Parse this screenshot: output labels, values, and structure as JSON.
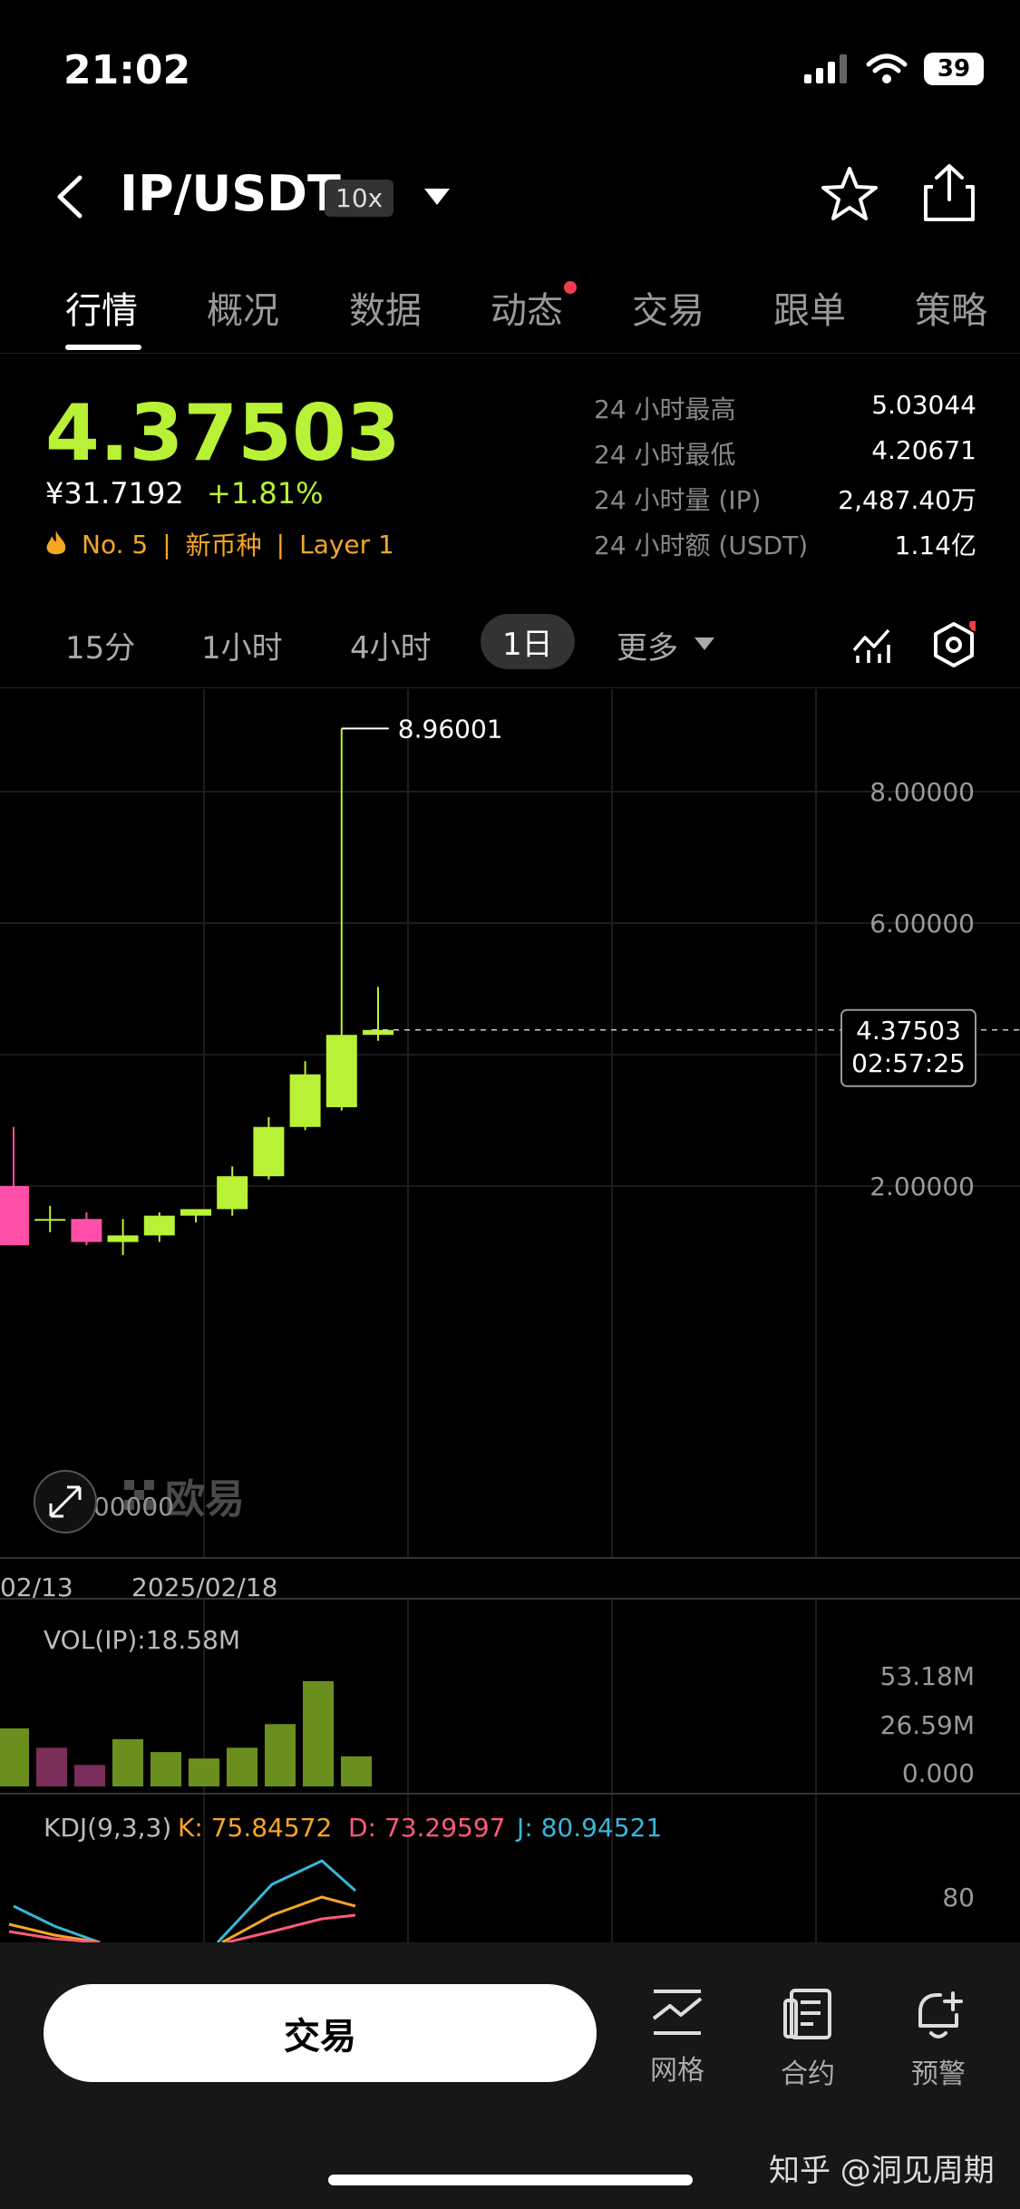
{
  "status": {
    "time": "21:02",
    "battery": "39"
  },
  "header": {
    "pair": "IP/USDT",
    "leverage": "10x"
  },
  "tabs": [
    {
      "label": "行情"
    },
    {
      "label": "概况"
    },
    {
      "label": "数据"
    },
    {
      "label": "动态"
    },
    {
      "label": "交易"
    },
    {
      "label": "跟单"
    },
    {
      "label": "策略"
    }
  ],
  "ticker": {
    "price": "4.37503",
    "price_cny": "¥31.7192",
    "change": "+1.81%",
    "rank": "No. 5",
    "tag_new": "新币种",
    "tag_layer": "Layer 1",
    "stats": [
      {
        "label": "24 小时最高",
        "value": "5.03044"
      },
      {
        "label": "24 小时最低",
        "value": "4.20671"
      },
      {
        "label": "24 小时量 (IP)",
        "value": "2,487.40万"
      },
      {
        "label": "24 小时额 (USDT)",
        "value": "1.14亿"
      }
    ]
  },
  "timeframes": {
    "m15": "15分",
    "h1": "1小时",
    "h4": "4小时",
    "d1": "1日",
    "more": "更多"
  },
  "colors": {
    "up": "#b8f135",
    "down": "#ff4fa8",
    "vol_up": "#6b8f1e",
    "vol_down": "#7a2e5a",
    "k": "#f5a623",
    "d": "#ff5a7a",
    "j": "#38b6d8"
  },
  "chart_data": {
    "type": "candlestick",
    "price_axis": {
      "ticks": [
        "8.00000",
        "6.00000",
        "2.00000",
        "1.00000"
      ],
      "ylim": [
        1.0,
        9.0
      ]
    },
    "dates": {
      "d1": "02/13",
      "d2": "2025/02/18"
    },
    "high_label": "8.96001",
    "current": {
      "price": "4.37503",
      "countdown": "02:57:25"
    },
    "candles": [
      {
        "o": 2.0,
        "h": 2.9,
        "l": 1.1,
        "c": 1.1
      },
      {
        "o": 1.5,
        "h": 1.7,
        "l": 1.3,
        "c": 1.5
      },
      {
        "o": 1.5,
        "h": 1.6,
        "l": 1.1,
        "c": 1.15
      },
      {
        "o": 1.15,
        "h": 1.5,
        "l": 0.95,
        "c": 1.25
      },
      {
        "o": 1.25,
        "h": 1.6,
        "l": 1.15,
        "c": 1.55
      },
      {
        "o": 1.55,
        "h": 1.6,
        "l": 1.45,
        "c": 1.65
      },
      {
        "o": 1.65,
        "h": 2.3,
        "l": 1.55,
        "c": 2.15
      },
      {
        "o": 2.15,
        "h": 3.05,
        "l": 2.1,
        "c": 2.9
      },
      {
        "o": 2.9,
        "h": 3.9,
        "l": 2.85,
        "c": 3.7
      },
      {
        "o": 3.2,
        "h": 8.96,
        "l": 3.15,
        "c": 4.3
      },
      {
        "o": 4.3,
        "h": 5.03,
        "l": 4.21,
        "c": 4.37503
      }
    ],
    "volume": {
      "label": "VOL(IP):18.58M",
      "ticks": [
        "53.18M",
        "26.59M",
        "0.000"
      ],
      "max": 53.18,
      "values": [
        27,
        18,
        10,
        22,
        16,
        13,
        18,
        29,
        49,
        14
      ],
      "directions": [
        "up",
        "down",
        "down",
        "up",
        "up",
        "up",
        "up",
        "up",
        "up",
        "up"
      ]
    },
    "kdj": {
      "label": "KDJ(9,3,3)",
      "k_label": "K: 75.84572",
      "d_label": "D: 73.29597",
      "j_label": "J: 80.94521",
      "tick": "80"
    }
  },
  "watermark_logo": "欧易",
  "bottom": {
    "trade": "交易",
    "grid": "网格",
    "contract": "合约",
    "alert": "预警",
    "watermark": "知乎 @洞见周期"
  }
}
